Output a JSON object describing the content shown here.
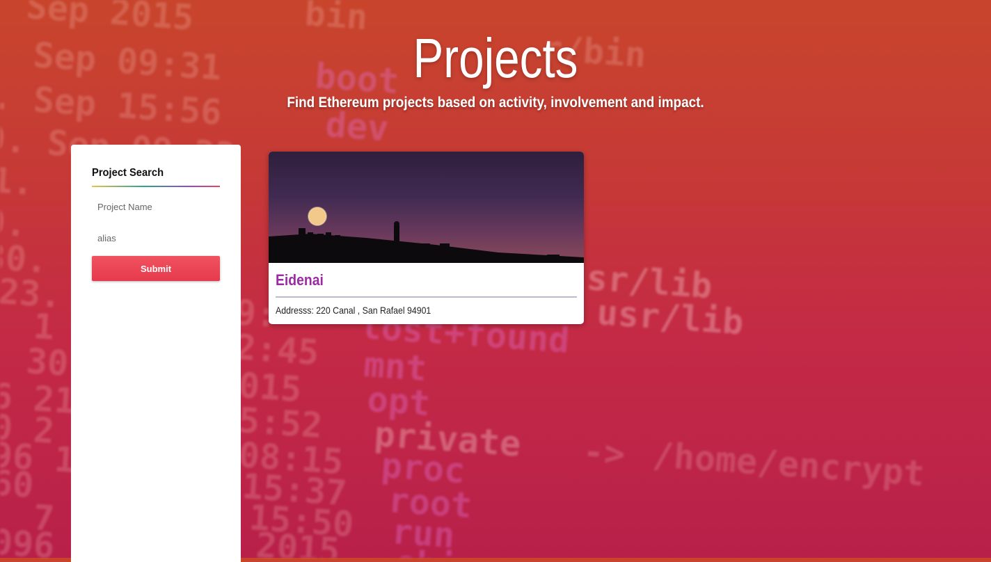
{
  "header": {
    "title": "Projects",
    "subtitle": "Find Ethereum projects based on activity, involvement and impact."
  },
  "sidebar": {
    "heading": "Project Search",
    "project_name_placeholder": "Project Name",
    "alias_placeholder": "alias",
    "submit_label": "Submit"
  },
  "results": [
    {
      "name": "Eidenai",
      "address": "Addresss: 220 Canal , San Rafael 94901"
    }
  ],
  "colors": {
    "accent": "#e53a4d",
    "project_name": "#9b2aa3"
  }
}
